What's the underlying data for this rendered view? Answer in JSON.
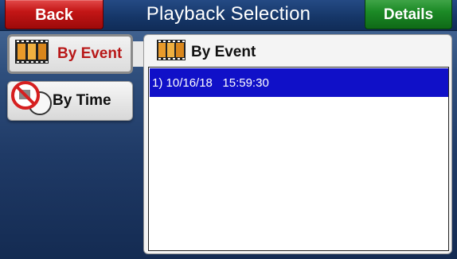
{
  "header": {
    "title": "Playback Selection",
    "back_label": "Back",
    "details_label": "Details"
  },
  "sidebar": {
    "items": [
      {
        "label": "By Event",
        "icon": "film-strip-icon",
        "active": true
      },
      {
        "label": "By Time",
        "icon": "no-clock-icon",
        "active": false
      }
    ]
  },
  "panel": {
    "title": "By Event",
    "icon": "film-strip-icon",
    "rows": [
      {
        "text": "1) 10/16/18   15:59:30",
        "selected": true
      }
    ]
  },
  "colors": {
    "back_button": "#c31616",
    "details_button": "#1c8a26",
    "selection_highlight": "#1010c8",
    "active_tab_text": "#b81818"
  }
}
